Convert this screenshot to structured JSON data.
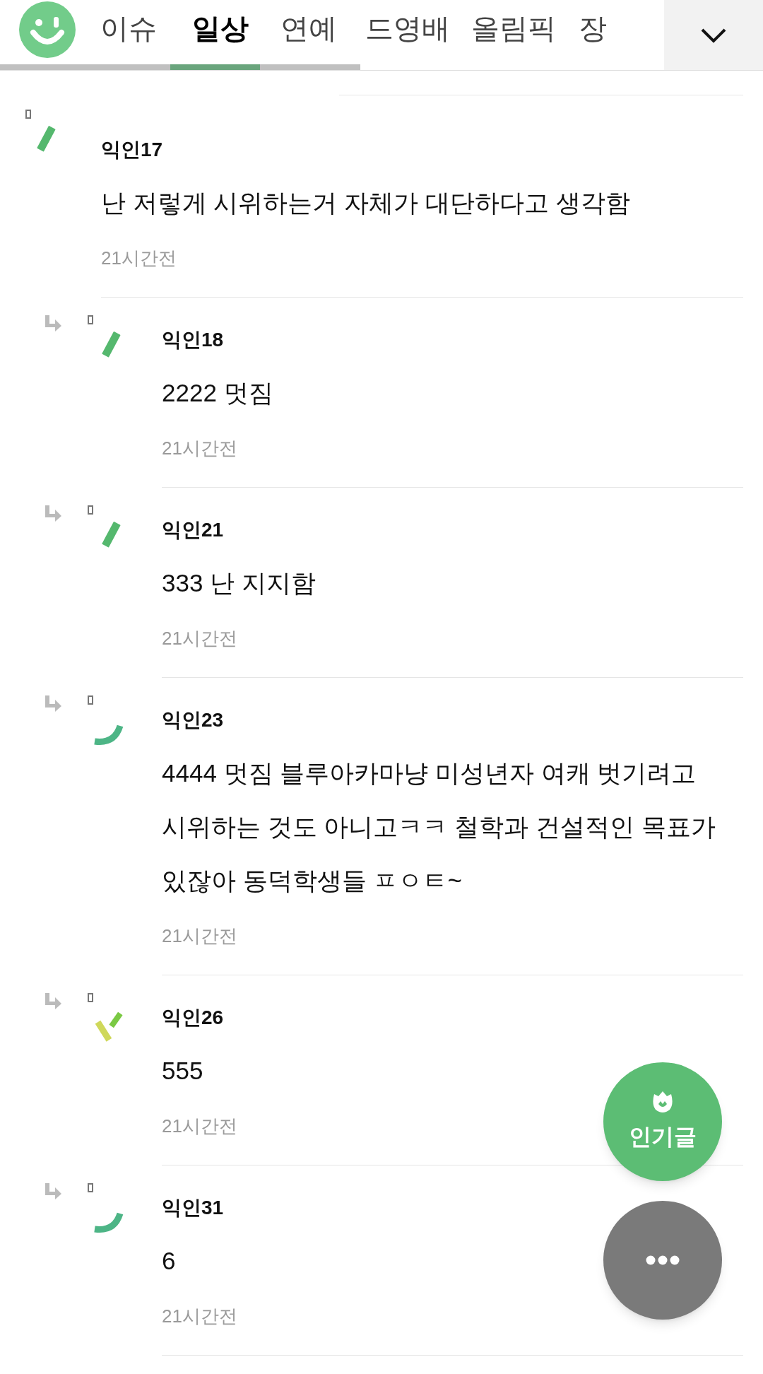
{
  "header": {
    "tabs": [
      {
        "label": "이슈",
        "selected": false
      },
      {
        "label": "일상",
        "selected": true
      },
      {
        "label": "연예",
        "selected": false
      },
      {
        "label": "드영배",
        "selected": false
      },
      {
        "label": "올림픽",
        "selected": false
      },
      {
        "label": "장",
        "selected": false
      }
    ]
  },
  "comments": [
    {
      "author": "익인17",
      "text": "난 저렇게 시위하는거 자체가 대단하다고 생각함",
      "time": "21시간전",
      "avatar": {
        "kind": "bar"
      },
      "children": [
        {
          "author": "익인18",
          "text": "2222 멋짐",
          "time": "21시간전",
          "avatar": {
            "kind": "bar"
          }
        },
        {
          "author": "익인21",
          "text": "333 난 지지함",
          "time": "21시간전",
          "avatar": {
            "kind": "bar"
          }
        },
        {
          "author": "익인23",
          "text": "4444 멋짐 블루아카마냥 미성년자 여캐 벗기려고 시위하는 것도 아니고ㅋㅋ 철학과 건설적인 목표가 있잖아 동덕학생들 ㅍㅇㅌ~",
          "time": "21시간전",
          "avatar": {
            "kind": "arc"
          }
        },
        {
          "author": "익인26",
          "text": "555",
          "time": "21시간전",
          "avatar": {
            "kind": "split"
          }
        },
        {
          "author": "익인31",
          "text": "6",
          "time": "21시간전",
          "avatar": {
            "kind": "arc"
          }
        }
      ]
    }
  ],
  "fab": {
    "popular_label": "인기글"
  }
}
